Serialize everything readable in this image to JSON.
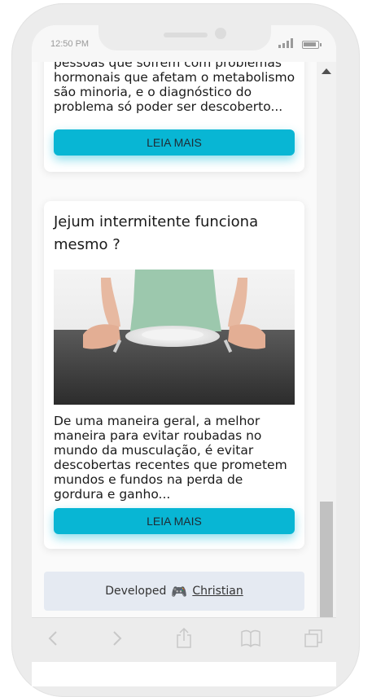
{
  "status_bar": {
    "time": "12:50 PM"
  },
  "cards": [
    {
      "text": "pessoas que sofrem com problemas hormonais que afetam o metabolismo são minoria, e o diagnóstico do problema só poder ser descoberto...",
      "button_label": "LEIA MAIS"
    },
    {
      "title": "Jejum intermitente funciona mesmo ?",
      "image_alt": "Woman sitting at table with empty plate",
      "text": "De uma maneira geral, a melhor maneira para evitar roubadas no mundo da musculação, é evitar descobertas recentes que prometem mundos e fundos na perda de gordura e ganho...",
      "button_label": "LEIA MAIS"
    }
  ],
  "footer": {
    "developed_label": "Developed",
    "icon": "gamepad-icon",
    "author_link": "Christian"
  },
  "toolbar": {
    "icons": [
      "back-icon",
      "forward-icon",
      "share-icon",
      "bookmarks-icon",
      "tabs-icon"
    ]
  },
  "colors": {
    "accent": "#08b6d4",
    "footer_bg": "#e5eaf2",
    "phone_frame": "#ececec"
  }
}
